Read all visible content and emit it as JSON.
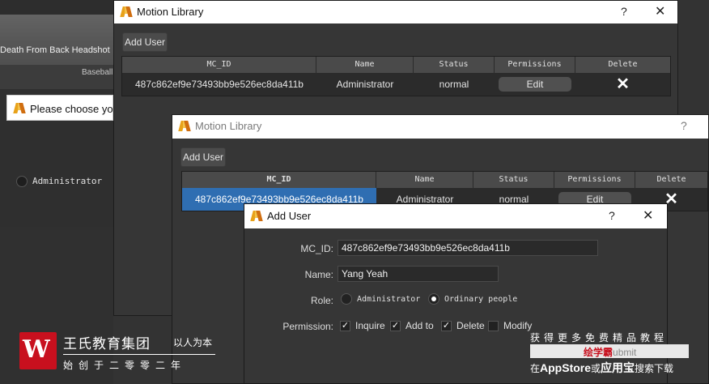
{
  "background": {
    "caption": "Death From Back Headshot",
    "panel_label": "Baseball",
    "choose_dialog_text": "Please choose yo",
    "radio_label": "Administrator"
  },
  "window1": {
    "title": "Motion Library",
    "help": "?",
    "close": "✕",
    "add_user_label": "Add User",
    "columns": [
      "MC_ID",
      "Name",
      "Status",
      "Permissions",
      "Delete"
    ],
    "row": {
      "mc_id": "487c862ef9e73493bb9e526ec8da411b",
      "name": "Administrator",
      "status": "normal",
      "edit": "Edit",
      "delete": "✕"
    }
  },
  "window2": {
    "title": "Motion Library",
    "help": "?",
    "add_user_label": "Add User",
    "columns": [
      "MC_ID",
      "Name",
      "Status",
      "Permissions",
      "Delete"
    ],
    "row": {
      "mc_id": "487c862ef9e73493bb9e526ec8da411b",
      "name": "Administrator",
      "status": "normal",
      "edit": "Edit",
      "delete": "✕"
    }
  },
  "add_user_dialog": {
    "title": "Add User",
    "help": "?",
    "close": "✕",
    "mc_id_label": "MC_ID:",
    "mc_id_value": "487c862ef9e73493bb9e526ec8da411b",
    "name_label": "Name:",
    "name_value": "Yang Yeah",
    "role_label": "Role:",
    "roles": [
      {
        "label": "Administrator",
        "selected": false
      },
      {
        "label": "Ordinary people",
        "selected": true
      }
    ],
    "permission_label": "Permission:",
    "permissions": [
      {
        "label": "Inquire",
        "checked": true
      },
      {
        "label": "Add to",
        "checked": true
      },
      {
        "label": "Delete",
        "checked": true
      },
      {
        "label": "Modify",
        "checked": false
      }
    ]
  },
  "watermark": {
    "logo_letter": "W",
    "org_name": "王氏教育集团",
    "slogan": "以人为本",
    "since": "始创于二零零二年",
    "promo1": "获得更多免费精品教程",
    "promo_bar_red": "绘学霸",
    "promo_bar_grey": "ubmit",
    "promo2_a": "在",
    "promo2_b": "AppStore",
    "promo2_c": "或",
    "promo2_d": "应用宝",
    "promo2_e": "搜索下载"
  }
}
